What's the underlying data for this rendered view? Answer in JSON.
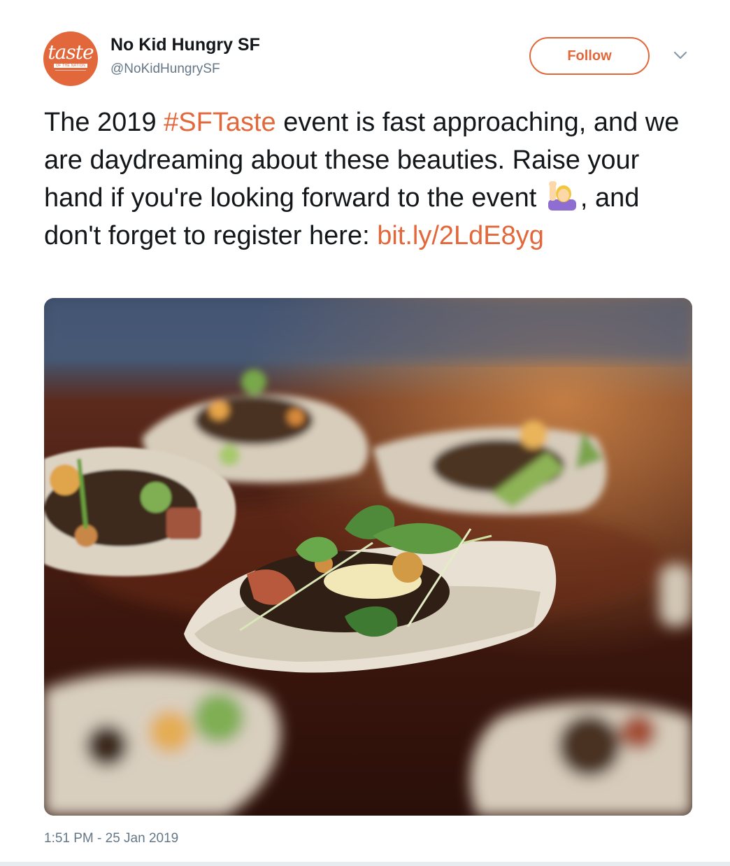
{
  "account": {
    "name": "No Kid Hungry SF",
    "handle": "@NoKidHungrySF",
    "avatar_logo": "taste",
    "avatar_sub": "OF THE NATION"
  },
  "follow_button": {
    "label": "Follow"
  },
  "tweet": {
    "text_before_hashtag": "The 2019 ",
    "hashtag": "#SFTaste",
    "text_after_hashtag": " event is fast approaching, and we are daydreaming about these beauties. Raise your hand if you're looking forward to the event ",
    "emoji": "person-raising-hand",
    "text_after_emoji": ", and don't forget to register here: ",
    "link": "bit.ly/2LdE8yg"
  },
  "timestamp": "1:51 PM - 25 Jan 2019",
  "colors": {
    "accent": "#e2673a",
    "text": "#14171a",
    "secondary": "#657786",
    "divider": "#e6ecf0"
  }
}
